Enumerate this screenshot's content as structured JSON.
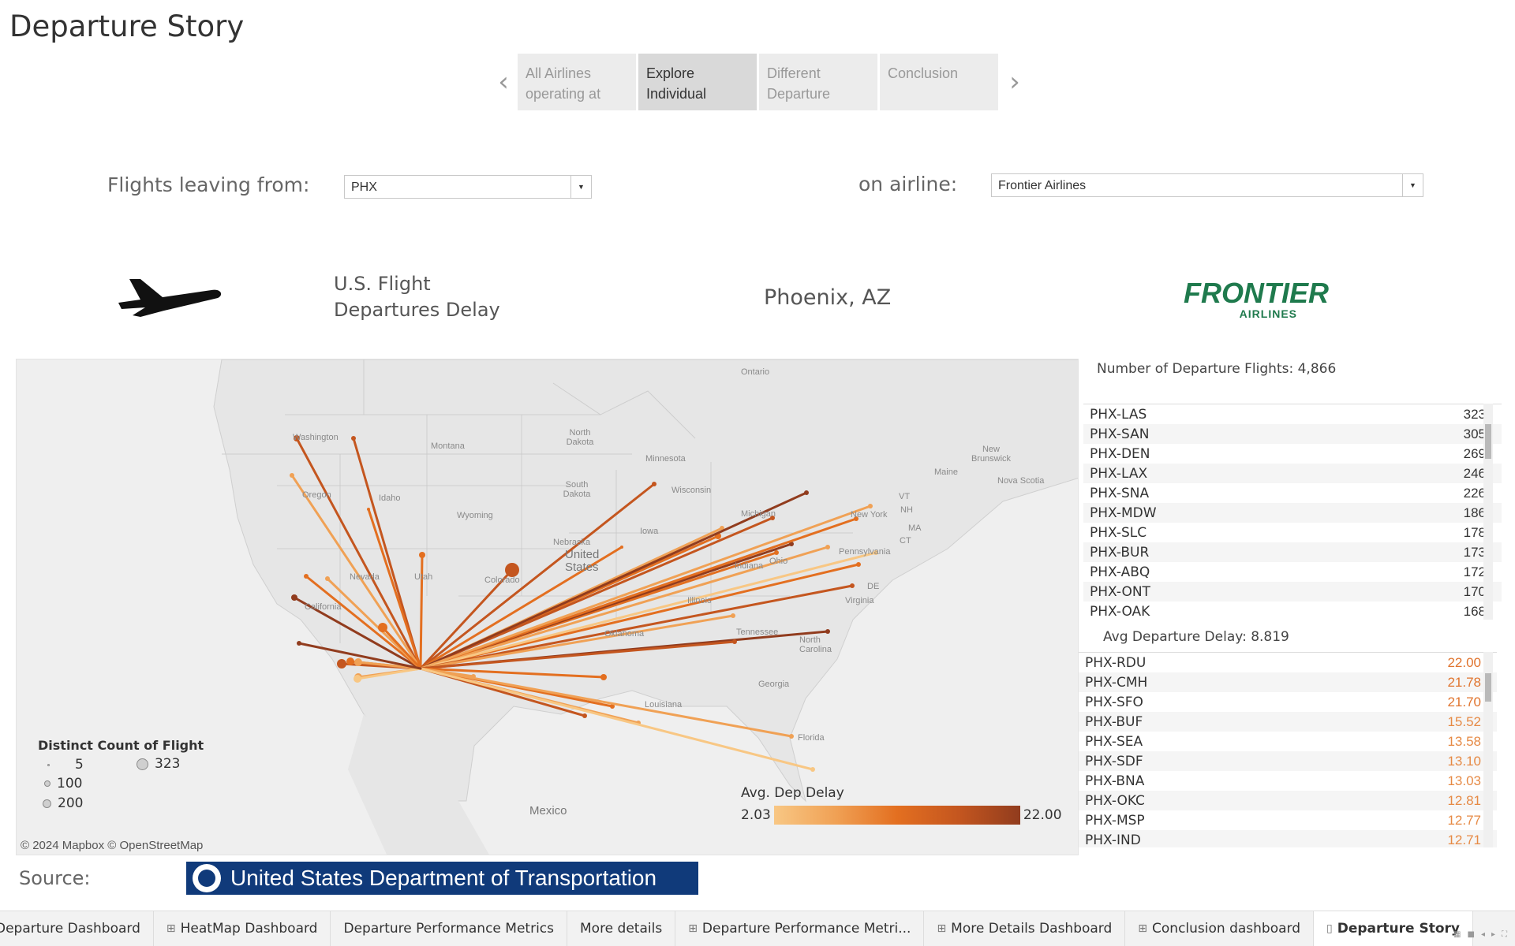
{
  "story": {
    "title": "Departure Story"
  },
  "navigator": {
    "points": [
      {
        "label": "All Airlines operating at",
        "active": false
      },
      {
        "label": "Explore Individual",
        "active": true
      },
      {
        "label": "Different Departure",
        "active": false
      },
      {
        "label": "Conclusion",
        "active": false
      }
    ]
  },
  "filters": {
    "origin_label": "Flights leaving from:",
    "origin_value": "PHX",
    "airline_label": "on  airline:",
    "airline_value": "Frontier Airlines"
  },
  "header": {
    "title_line1": "U.S. Flight",
    "title_line2": "Departures Delay",
    "city": "Phoenix, AZ",
    "logo_word": "FRONTIER",
    "logo_sub": "AIRLINES"
  },
  "map": {
    "labels": [
      "Ontario",
      "Washington",
      "Montana",
      "North Dakota",
      "Minnesota",
      "South Dakota",
      "Wisconsin",
      "Michigan",
      "New York",
      "Maine",
      "New Brunswick",
      "Nova Scotia",
      "Idaho",
      "Wyoming",
      "Nebraska",
      "United States",
      "Iowa",
      "Ohio",
      "Pennsylvania",
      "Nevada",
      "Utah",
      "Colorado",
      "Indiana",
      "California",
      "Illinois",
      "Virginia",
      "DE",
      "VT",
      "NH",
      "CT",
      "MA",
      "Tennessee",
      "North Carolina",
      "Georgia",
      "Louisiana",
      "Florida",
      "Mexico",
      "Oregon",
      "Oklahoma"
    ],
    "attribution": "© 2024 Mapbox © OpenStreetMap"
  },
  "size_legend": {
    "title": "Distinct Count of Flight",
    "entries": [
      "5",
      "100",
      "200",
      "323"
    ]
  },
  "color_legend": {
    "title": "Avg. Dep Delay",
    "min": "2.03",
    "max": "22.00",
    "colors": [
      "#f8c784",
      "#f0a155",
      "#e36f20",
      "#c4561f",
      "#913c1e"
    ]
  },
  "flight_counts": {
    "title": "Number of Departure Flights: 4,866",
    "rows": [
      {
        "route": "PHX-LAS",
        "value": "323"
      },
      {
        "route": "PHX-SAN",
        "value": "305"
      },
      {
        "route": "PHX-DEN",
        "value": "269"
      },
      {
        "route": "PHX-LAX",
        "value": "246"
      },
      {
        "route": "PHX-SNA",
        "value": "226"
      },
      {
        "route": "PHX-MDW",
        "value": "186"
      },
      {
        "route": "PHX-SLC",
        "value": "178"
      },
      {
        "route": "PHX-BUR",
        "value": "173"
      },
      {
        "route": "PHX-ABQ",
        "value": "172"
      },
      {
        "route": "PHX-ONT",
        "value": "170"
      },
      {
        "route": "PHX-OAK",
        "value": "168"
      }
    ]
  },
  "avg_delay": {
    "title": "Avg Departure Delay: 8.819",
    "rows": [
      {
        "route": "PHX-RDU",
        "value": "22.00",
        "color": "#e0742e"
      },
      {
        "route": "PHX-CMH",
        "value": "21.78",
        "color": "#e0742e"
      },
      {
        "route": "PHX-SFO",
        "value": "21.70",
        "color": "#e0742e"
      },
      {
        "route": "PHX-BUF",
        "value": "15.52",
        "color": "#e68a45"
      },
      {
        "route": "PHX-SEA",
        "value": "13.58",
        "color": "#e68a45"
      },
      {
        "route": "PHX-SDF",
        "value": "13.10",
        "color": "#e68a45"
      },
      {
        "route": "PHX-BNA",
        "value": "13.03",
        "color": "#e68a45"
      },
      {
        "route": "PHX-OKC",
        "value": "12.81",
        "color": "#e68a45"
      },
      {
        "route": "PHX-MSP",
        "value": "12.77",
        "color": "#e68a45"
      },
      {
        "route": "PHX-IND",
        "value": "12.71",
        "color": "#e68a45"
      }
    ]
  },
  "source": {
    "label": "Source:",
    "banner_text": "United States Department of Transportation"
  },
  "tabs": [
    {
      "label": "Departure Dashboard",
      "icon": "",
      "active": false
    },
    {
      "label": "HeatMap Dashboard",
      "icon": "dashboard-icon",
      "active": false
    },
    {
      "label": "Departure Performance Metrics",
      "icon": "",
      "active": false
    },
    {
      "label": "More details",
      "icon": "",
      "active": false
    },
    {
      "label": "Departure Performance Metri...",
      "icon": "dashboard-icon",
      "active": false
    },
    {
      "label": "More Details Dashboard",
      "icon": "dashboard-icon",
      "active": false
    },
    {
      "label": "Conclusion dashboard",
      "icon": "dashboard-icon",
      "active": false
    },
    {
      "label": "Departure Story",
      "icon": "story-icon",
      "active": true
    }
  ]
}
